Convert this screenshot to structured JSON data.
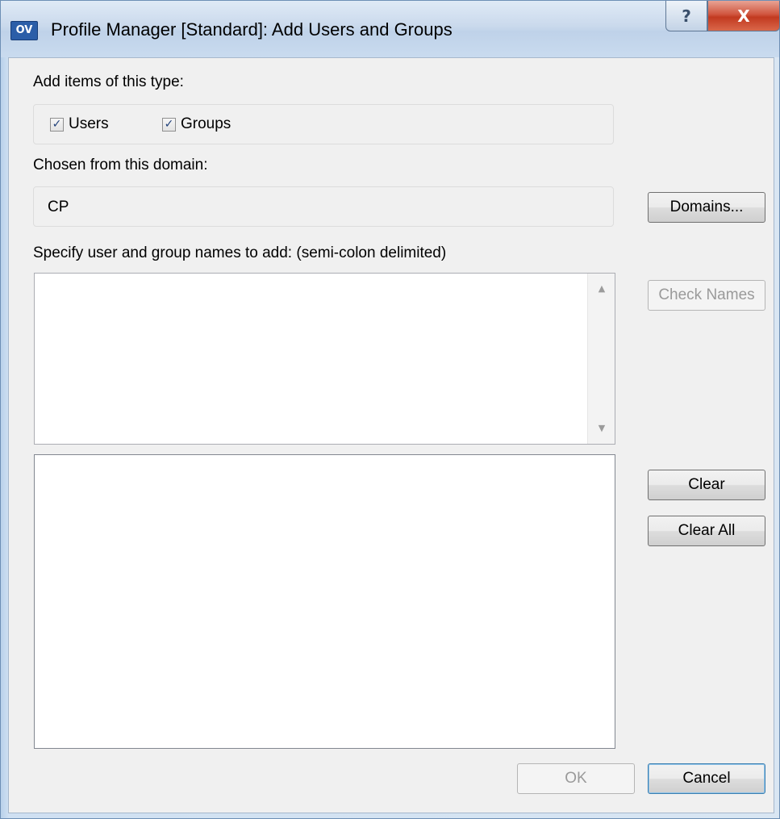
{
  "window": {
    "title": "Profile Manager [Standard]: Add Users and Groups",
    "app_icon_text": "OV",
    "help_glyph": "?",
    "close_glyph": "X"
  },
  "item_types": {
    "label": "Add items of this type:",
    "users": {
      "label": "Users",
      "checked": true
    },
    "groups": {
      "label": "Groups",
      "checked": true
    }
  },
  "domain": {
    "label": "Chosen from this domain:",
    "value": "CP",
    "button": "Domains..."
  },
  "names": {
    "label": "Specify user and group names to add: (semi-colon delimited)",
    "value": "",
    "check_names_button": "Check Names"
  },
  "selection": {
    "clear_button": "Clear",
    "clear_all_button": "Clear All"
  },
  "footer": {
    "ok_button": "OK",
    "cancel_button": "Cancel"
  },
  "glyphs": {
    "check_mark": "✓",
    "scroll_up": "▲",
    "scroll_down": "▼"
  },
  "colors": {
    "title_bar": "#cad9ec",
    "close_button": "#c23a20",
    "dialog_background": "#f0f0f0"
  }
}
